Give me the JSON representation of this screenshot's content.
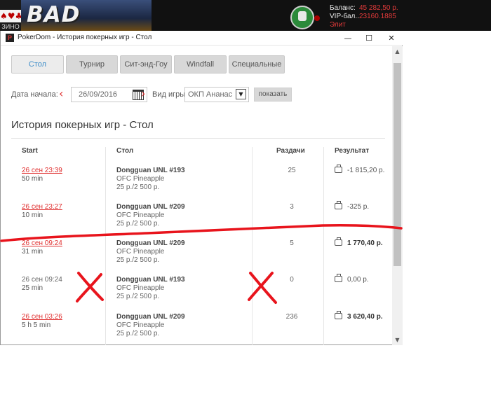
{
  "banner": {
    "game_title": "BAD BEAT",
    "casino_suits": "♠♥♣",
    "casino_sub": "ЗИНО",
    "balance_label": "Баланс:",
    "balance_value": "45 282,50 р.",
    "vip_label": "VIP-бал...",
    "vip_value": "23160.1885",
    "status_label": "Элит",
    "accent": "#e23a3a"
  },
  "window": {
    "title": "PokerDom - История покерных игр - Стол",
    "icon_letter": "P",
    "minimize": "—",
    "maximize": "☐",
    "close": "✕"
  },
  "tabs": [
    {
      "label": "Стол",
      "active": true
    },
    {
      "label": "Турнир",
      "active": false
    },
    {
      "label": "Сит-энд-Гоу",
      "active": false
    },
    {
      "label": "Windfall",
      "active": false
    },
    {
      "label": "Специальные",
      "active": false
    }
  ],
  "filters": {
    "start_date_label": "Дата начала:",
    "prev": "‹",
    "next": "›",
    "start_date": "26/09/2016",
    "game_type_label": "Вид игры:",
    "game_type": "ОКП Ананас",
    "show_button": "показать"
  },
  "heading": "История покерных игр - Стол",
  "table": {
    "columns": {
      "start": "Start",
      "table": "Стол",
      "hands": "Раздачи",
      "result": "Результат"
    },
    "rows": [
      {
        "start": "26 сен 23:39",
        "duration": "50 min",
        "table_name": "Dongguan UNL #193",
        "variant": "OFC Pineapple",
        "stakes": "25 р./2 500 р.",
        "hands": "25",
        "result": "-1 815,20 р.",
        "link": true,
        "bold": false
      },
      {
        "start": "26 сен 23:27",
        "duration": "10 min",
        "table_name": "Dongguan UNL #209",
        "variant": "OFC Pineapple",
        "stakes": "25 р./2 500 р.",
        "hands": "3",
        "result": "-325 р.",
        "link": true,
        "bold": false
      },
      {
        "start": "26 сен 09:24",
        "duration": "31 min",
        "table_name": "Dongguan UNL #209",
        "variant": "OFC Pineapple",
        "stakes": "25 р./2 500 р.",
        "hands": "5",
        "result": "1 770,40 р.",
        "link": true,
        "bold": true
      },
      {
        "start": "26 сен 09:24",
        "duration": "25 min",
        "table_name": "Dongguan UNL #193",
        "variant": "OFC Pineapple",
        "stakes": "25 р./2 500 р.",
        "hands": "0",
        "result": "0,00 р.",
        "link": false,
        "bold": false
      },
      {
        "start": "26 сен 03:26",
        "duration": "5 h 5 min",
        "table_name": "Dongguan UNL #209",
        "variant": "OFC Pineapple",
        "stakes": "25 р./2 500 р.",
        "hands": "236",
        "result": "3 620,40 р.",
        "link": true,
        "bold": true
      }
    ]
  },
  "scrollbar": {
    "up": "▲",
    "down": "▼"
  },
  "annotation_color": "#e8141c"
}
